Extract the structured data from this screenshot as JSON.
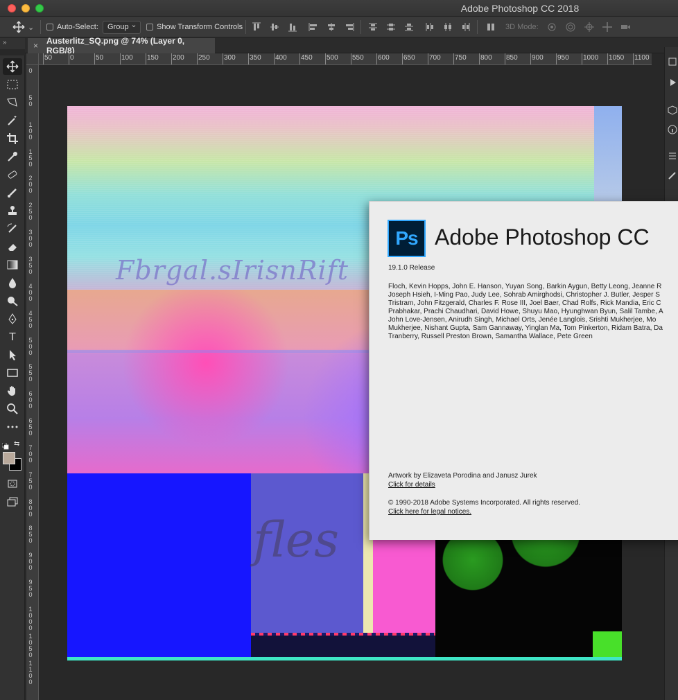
{
  "window": {
    "title": "Adobe Photoshop CC 2018"
  },
  "options_bar": {
    "auto_select_label": "Auto-Select:",
    "auto_select_value": "Group",
    "show_transform_label": "Show Transform Controls",
    "mode3d_label": "3D Mode:"
  },
  "collapse_glyph": "»",
  "document_tab": {
    "close_glyph": "×",
    "title": "Austerlitz_SQ.png @ 74% (Layer 0, RGB/8)"
  },
  "ruler_top": [
    "50",
    "0",
    "50",
    "100",
    "150",
    "200",
    "250",
    "300",
    "350",
    "400",
    "450",
    "500",
    "550",
    "600",
    "650",
    "700",
    "750",
    "800",
    "850",
    "900",
    "950",
    "1000",
    "1050",
    "1100"
  ],
  "ruler_left": [
    "0",
    "50",
    "100",
    "150",
    "200",
    "250",
    "300",
    "350",
    "400",
    "450",
    "500",
    "550",
    "600",
    "650",
    "700",
    "750",
    "800",
    "850",
    "900",
    "950",
    "1000",
    "1050",
    "1100"
  ],
  "artwork": {
    "script_text_1": "Fbrgal.sIrisnRift",
    "script_text_2": "fles"
  },
  "about": {
    "logo_text": "Ps",
    "title": "Adobe Photoshop CC",
    "version": "19.1.0 Release",
    "credits": [
      "Floch, Kevin Hopps, John E. Hanson, Yuyan Song, Barkin Aygun, Betty Leong, Jeanne R",
      "Joseph Hsieh, I-Ming Pao, Judy Lee, Sohrab Amirghodsi, Christopher J. Butler, Jesper S",
      "Tristram, John Fitzgerald, Charles F. Rose III, Joel Baer, Chad Rolfs, Rick Mandia, Eric C",
      "Prabhakar, Prachi Chaudhari, David Howe, Shuyu Mao, Hyunghwan Byun, Salil Tambe, A",
      "John Love-Jensen, Anirudh Singh, Michael Orts, Jenée Langlois, Srishti Mukherjee, Mo",
      "Mukherjee, Nishant Gupta, Sam Gannaway, Yinglan Ma, Tom Pinkerton, Ridam Batra, Da",
      "Tranberry, Russell Preston Brown, Samantha Wallace, Pete Green"
    ],
    "artwork_credit": "Artwork by Elizaveta Porodina and Janusz Jurek",
    "details_link": "Click for details",
    "copyright": "© 1990-2018 Adobe Systems Incorporated. All rights reserved.",
    "legal_link": "Click here for legal notices."
  },
  "colors": {
    "ps_dark": "#001e36",
    "ps_blue": "#31a8ff",
    "dialog_bg": "#ececec",
    "app_bg": "#282828"
  }
}
